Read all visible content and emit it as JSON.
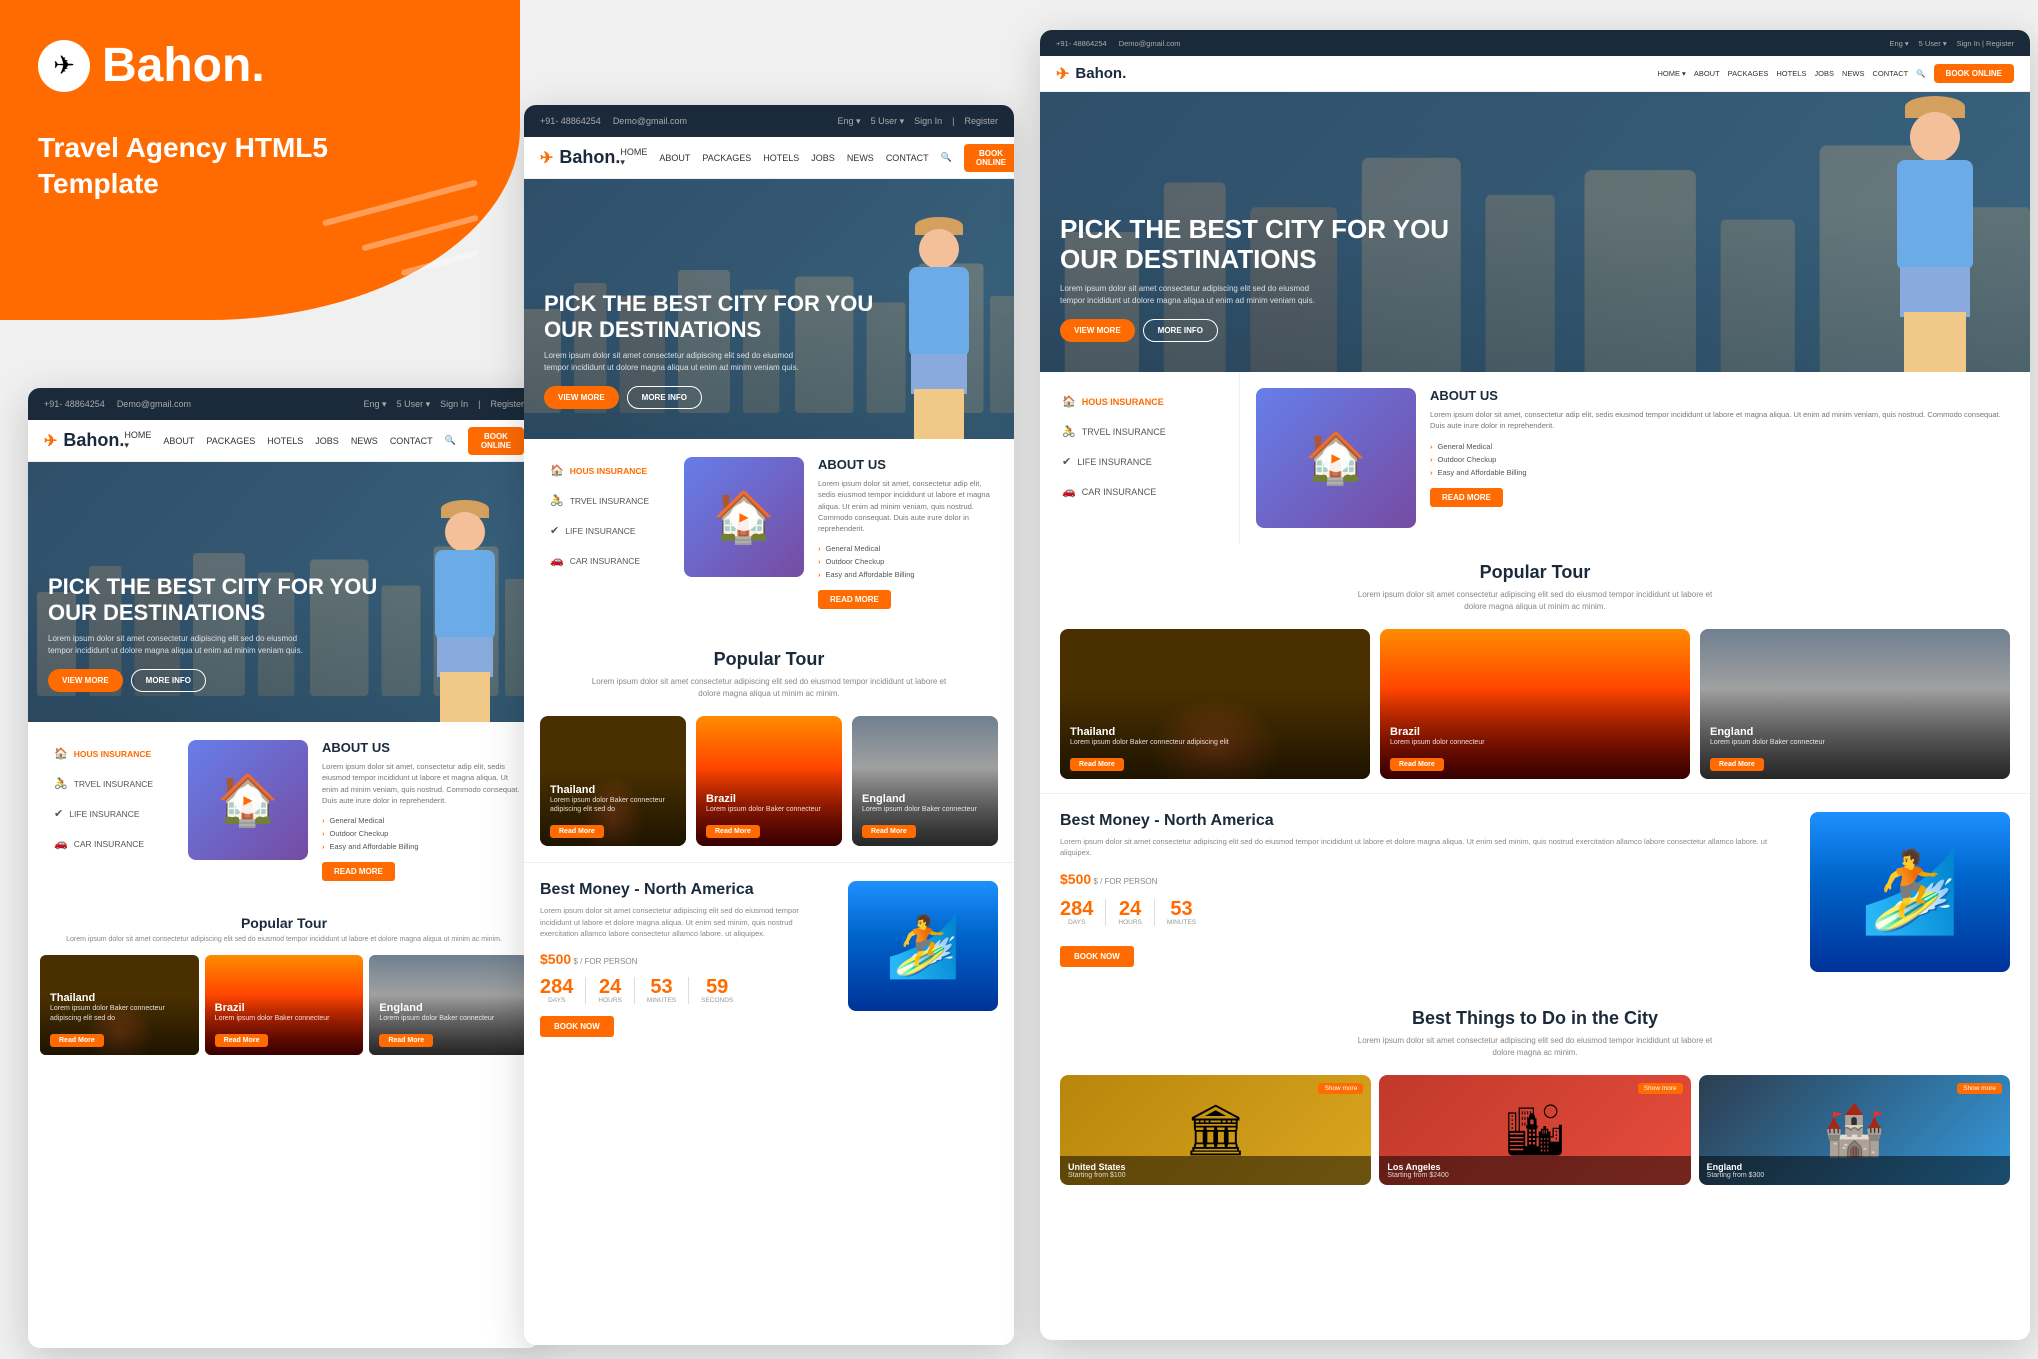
{
  "brand": {
    "name": "Bahon.",
    "tagline": "Travel Agency HTML5\nTemplate",
    "plane_unicode": "✈"
  },
  "navbar_top": {
    "phone": "+91- 48864254",
    "email": "Demo@gmail.com",
    "lang": "Eng ▾",
    "user_count": "5 User ▾",
    "sign_in": "Sign In",
    "register": "Register"
  },
  "nav_main": {
    "logo": "Bahon.",
    "links": [
      "HOME ▾",
      "ABOUT",
      "PACKAGES",
      "HOTELS",
      "JOBS",
      "NEWS",
      "CONTACT"
    ],
    "search_icon": "🔍",
    "book_btn": "BOOK ONLINE"
  },
  "hero": {
    "title": "PICK THE BEST CITY FOR YOU\nOUR DESTINATIONS",
    "subtitle": "Lorem ipsum dolor sit amet consectetur adipiscing elit sed do eiusmod tempor incididunt ut dolore magna aliqua ut enim ad minim veniam quis.",
    "view_more": "VIEW MORE",
    "more_info": "MORE INFO"
  },
  "about": {
    "heading": "ABOUT US",
    "description": "Lorem ipsum dolor sit amet, consectetur adip elit, sedis eiusmod tempor incididunt ut labore et magna aliqua. Ut enim ad minim veniam, quis nostrud. Commodo consequat. Duis aute irure dolor in reprehenderit.",
    "features": [
      "General Medical",
      "Outdoor Checkup",
      "Easy and Affordable Billing"
    ],
    "read_more": "READ MORE",
    "insurance_items": [
      {
        "label": "HOUS INSURANCE",
        "icon": "🏠",
        "active": true
      },
      {
        "label": "TRVEL INSURANCE",
        "icon": "🚴",
        "active": false
      },
      {
        "label": "LIFE INSURANCE",
        "icon": "✔",
        "active": false
      },
      {
        "label": "CAR INSURANCE",
        "icon": "🚗",
        "active": false
      }
    ]
  },
  "popular_tour": {
    "title": "Popular Tour",
    "description": "Lorem ipsum dolor sit amet consectetur adipiscing elit sed do eiusmod tempor incididunt ut labore et dolore magna aliqua ut minim ac minim.",
    "cards": [
      {
        "name": "Thailand",
        "sub": "Lorem ipsum dolor Baker connecteur adipiscing elit sed do",
        "read_more": "Read More"
      },
      {
        "name": "Brazil",
        "sub": "Lorem ipsum dolor Baker connecteur adipiscing elit sed do",
        "read_more": "Read More"
      },
      {
        "name": "England",
        "sub": "Lorem ipsum dolor Baker connecteur adipiscing elit sed do",
        "read_more": "Read More"
      }
    ]
  },
  "best_money": {
    "title": "Best Money - North America",
    "description": "Lorem ipsum dolor sit amet consectetur adipiscing elit sed do eiusmod tempor incididunt ut labore et dolore magna aliqua. Ut enim sed minim, quis nostrud exercitation allamco labore consectetur allamco labore. ut aliquipex.",
    "price": "500",
    "price_prefix": "$",
    "per_person": "FOR PERSON",
    "book_now": "BOOK NOW",
    "stats": [
      {
        "number": "284",
        "label": "Days"
      },
      {
        "number": "24",
        "label": "Hours"
      },
      {
        "number": "53",
        "label": "Minutes"
      },
      {
        "number": "59",
        "label": "Seconds"
      }
    ]
  },
  "best_things": {
    "title": "Best Things to Do in the City",
    "description": "Lorem ipsum dolor sit amet consectetur adipiscing elit sed do eiusmod tempor incididunt ut labore et dolore magna ac minim.",
    "cards": [
      {
        "name": "United States",
        "price": "Starting from $100",
        "badge": "Show more"
      },
      {
        "name": "Los Angeles",
        "price": "Starting from $2400",
        "badge": "Show more"
      },
      {
        "name": "England",
        "price": "Starting from $300",
        "badge": "Show more"
      }
    ]
  },
  "colors": {
    "orange": "#FF6B00",
    "dark": "#1a2a3a",
    "light_gray": "#f0f0f0"
  }
}
